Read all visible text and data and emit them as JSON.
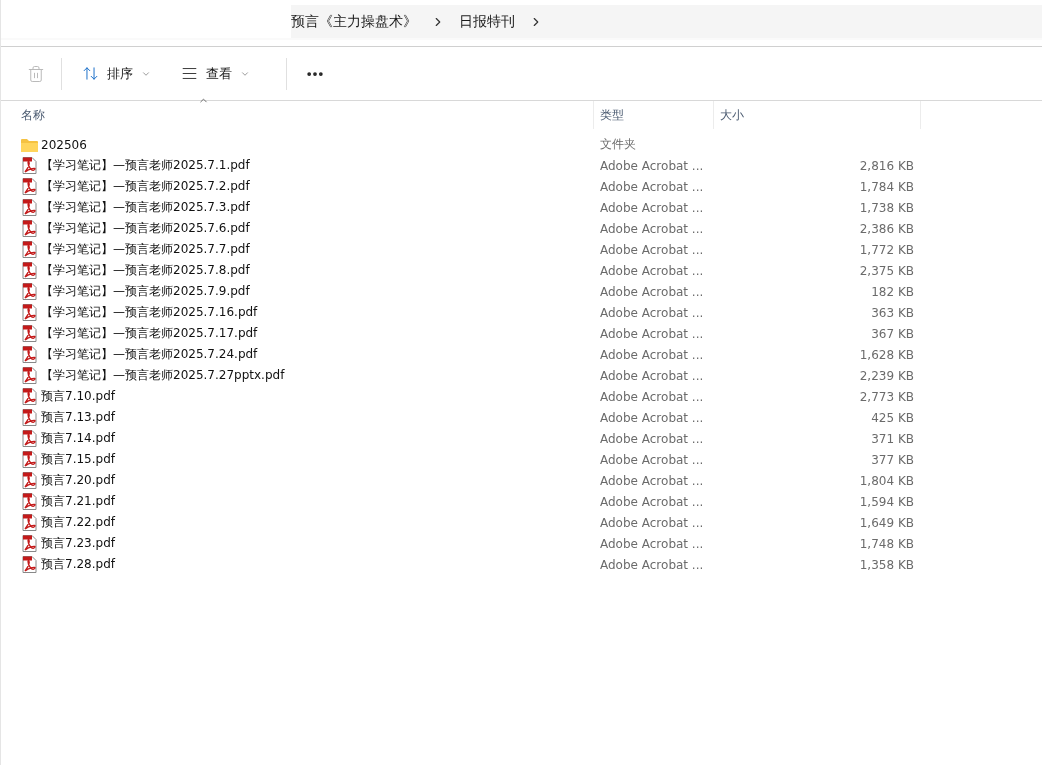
{
  "breadcrumb": [
    "预言《主力操盘术》",
    "日报特刊"
  ],
  "toolbar": {
    "delete_disabled": true,
    "sort_label": "排序",
    "view_label": "查看"
  },
  "columns": {
    "name": "名称",
    "type": "类型",
    "size": "大小"
  },
  "files": [
    {
      "kind": "folder",
      "name": "202506",
      "type": "文件夹"
    },
    {
      "kind": "pdf",
      "name": "【学习笔记】—预言老师2025.7.1.pdf",
      "type": "Adobe Acrobat ...",
      "size": "2,816 KB"
    },
    {
      "kind": "pdf",
      "name": "【学习笔记】—预言老师2025.7.2.pdf",
      "type": "Adobe Acrobat ...",
      "size": "1,784 KB"
    },
    {
      "kind": "pdf",
      "name": "【学习笔记】—预言老师2025.7.3.pdf",
      "type": "Adobe Acrobat ...",
      "size": "1,738 KB"
    },
    {
      "kind": "pdf",
      "name": "【学习笔记】—预言老师2025.7.6.pdf",
      "type": "Adobe Acrobat ...",
      "size": "2,386 KB"
    },
    {
      "kind": "pdf",
      "name": "【学习笔记】—预言老师2025.7.7.pdf",
      "type": "Adobe Acrobat ...",
      "size": "1,772 KB"
    },
    {
      "kind": "pdf",
      "name": "【学习笔记】—预言老师2025.7.8.pdf",
      "type": "Adobe Acrobat ...",
      "size": "2,375 KB"
    },
    {
      "kind": "pdf",
      "name": "【学习笔记】—预言老师2025.7.9.pdf",
      "type": "Adobe Acrobat ...",
      "size": "182 KB"
    },
    {
      "kind": "pdf",
      "name": "【学习笔记】—预言老师2025.7.16.pdf",
      "type": "Adobe Acrobat ...",
      "size": "363 KB"
    },
    {
      "kind": "pdf",
      "name": "【学习笔记】—预言老师2025.7.17.pdf",
      "type": "Adobe Acrobat ...",
      "size": "367 KB"
    },
    {
      "kind": "pdf",
      "name": "【学习笔记】—预言老师2025.7.24.pdf",
      "type": "Adobe Acrobat ...",
      "size": "1,628 KB"
    },
    {
      "kind": "pdf",
      "name": "【学习笔记】—预言老师2025.7.27pptx.pdf",
      "type": "Adobe Acrobat ...",
      "size": "2,239 KB"
    },
    {
      "kind": "pdf",
      "name": "预言7.10.pdf",
      "type": "Adobe Acrobat ...",
      "size": "2,773 KB"
    },
    {
      "kind": "pdf",
      "name": "预言7.13.pdf",
      "type": "Adobe Acrobat ...",
      "size": "425 KB"
    },
    {
      "kind": "pdf",
      "name": "预言7.14.pdf",
      "type": "Adobe Acrobat ...",
      "size": "371 KB"
    },
    {
      "kind": "pdf",
      "name": "预言7.15.pdf",
      "type": "Adobe Acrobat ...",
      "size": "377 KB"
    },
    {
      "kind": "pdf",
      "name": "预言7.20.pdf",
      "type": "Adobe Acrobat ...",
      "size": "1,804 KB"
    },
    {
      "kind": "pdf",
      "name": "预言7.21.pdf",
      "type": "Adobe Acrobat ...",
      "size": "1,594 KB"
    },
    {
      "kind": "pdf",
      "name": "预言7.22.pdf",
      "type": "Adobe Acrobat ...",
      "size": "1,649 KB"
    },
    {
      "kind": "pdf",
      "name": "预言7.23.pdf",
      "type": "Adobe Acrobat ...",
      "size": "1,748 KB"
    },
    {
      "kind": "pdf",
      "name": "预言7.28.pdf",
      "type": "Adobe Acrobat ...",
      "size": "1,358 KB"
    }
  ]
}
